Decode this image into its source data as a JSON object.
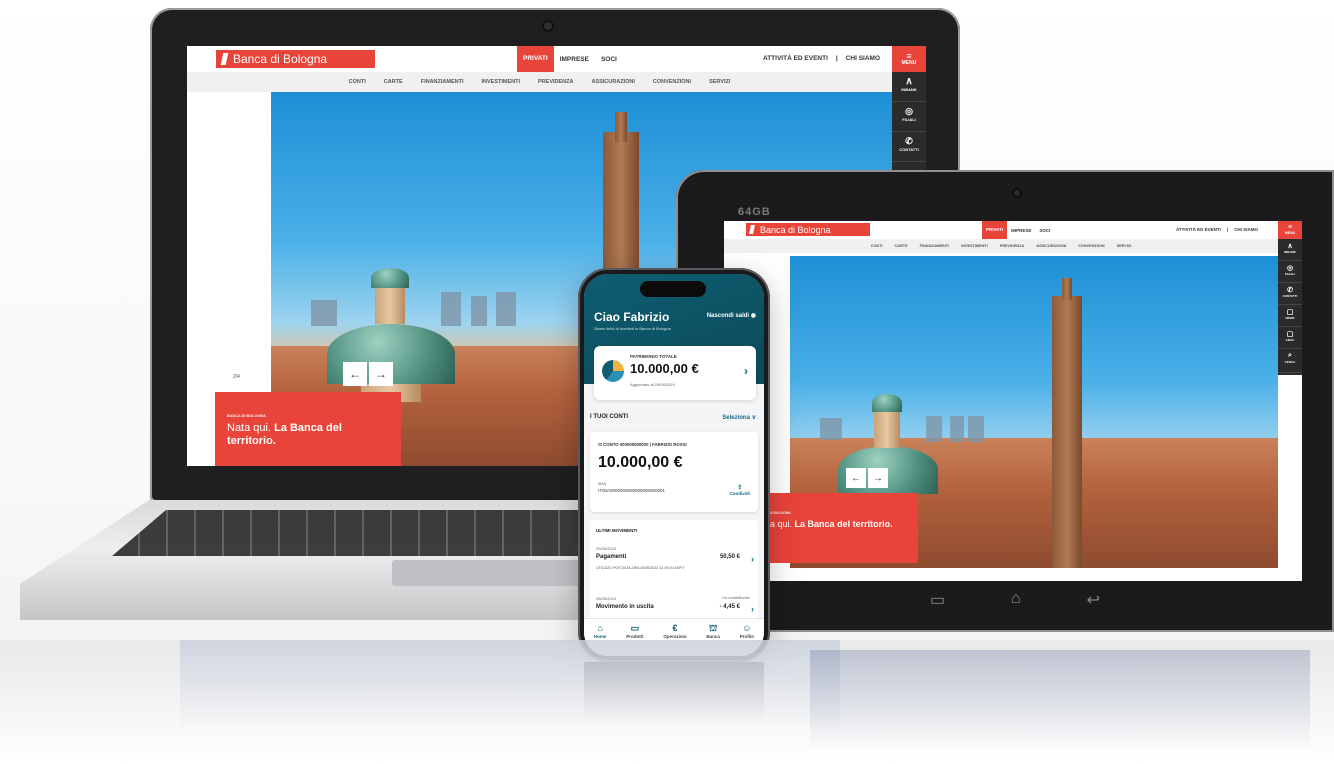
{
  "brand": {
    "name": "Banca di Bologna",
    "color": "#e8443a"
  },
  "site": {
    "top_nav": [
      "PRIVATI",
      "IMPRESE",
      "SOCI"
    ],
    "active_top": "PRIVATI",
    "right_nav": [
      "ATTIVITÀ ED EVENTI",
      "|",
      "CHI SIAMO"
    ],
    "sub_nav": [
      "CONTI",
      "CARTE",
      "FINANZIAMENTI",
      "INVESTIMENTI",
      "PREVIDENZA",
      "ASSICURAZIONI",
      "CONVENZIONI",
      "SERVIZI"
    ],
    "side_menu": {
      "menu": "MENU",
      "items": [
        "INBANK",
        "FILIALI",
        "CONTATTI",
        "NEWS",
        "ABAC",
        "CERCA"
      ]
    },
    "slide_counter": "2/4",
    "promo": {
      "kicker": "BANCA DI BOLOGNA",
      "text_light": "Nata qui.",
      "text_bold": "La Banca del territorio."
    }
  },
  "tablet": {
    "capacity": "64GB"
  },
  "phone": {
    "greeting": "Ciao Fabrizio",
    "hide_balance": "Nascondi saldi",
    "welcome": "Siamo felici di rivederti in Banca di Bologna",
    "patrimonio": {
      "label": "PATRIMONIO TOTALE",
      "value": "10.000,00 €",
      "updated": "Aggiornato al 29/05/2024"
    },
    "accounts_title": "I TUOI CONTI",
    "select": "Seleziona",
    "account": {
      "line": "CONTO 000000000000 | FABRIZIO ROSSI",
      "balance": "10.000,00 €",
      "iban_label": "IBAN",
      "iban": "IT00A0000000000000000000001",
      "share": "Condividi"
    },
    "movements": {
      "title": "ULTIMI MOVIMENTI",
      "items": [
        {
          "date": "29/05/2024",
          "name": "Pagamenti",
          "amount": "50,50 €",
          "detail": "UTILIZZO POS DATA-ORA 26/05/2024 12.49.00 ASPIT",
          "status": ""
        },
        {
          "date": "28/05/2024",
          "name": "Movimento in uscita",
          "amount": "- 4,45 €",
          "detail": "",
          "status": "Da contabilizzare"
        }
      ]
    },
    "tabs": [
      "Home",
      "Prodotti",
      "Operazioni",
      "Banca",
      "Profilo"
    ]
  }
}
